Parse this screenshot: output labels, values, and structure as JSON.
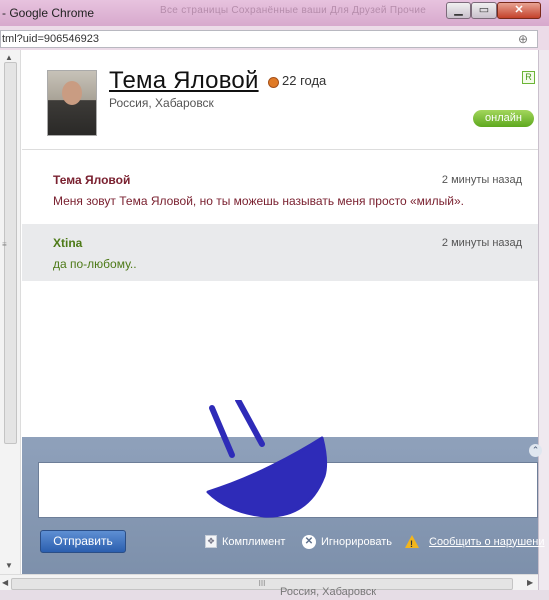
{
  "window": {
    "title": "- Google Chrome",
    "tab_ghost": "Все страницы   Сохранённые ваши   Для Друзей   Прочие"
  },
  "address": {
    "url": "tml?uid=906546923"
  },
  "profile": {
    "name": "Тема Яловой",
    "age": "22 года",
    "location": "Россия, Хабаровск",
    "badge": "R",
    "status": "онлайн"
  },
  "messages": [
    {
      "author": "Тема Яловой",
      "time": "2 минуты назад",
      "text": "Меня зовут Тема Яловой, но ты можешь называть меня просто «милый»."
    },
    {
      "author": "Xtina",
      "time": "2 минуты назад",
      "text": "да по-любому.."
    }
  ],
  "composer": {
    "send_label": "Отправить",
    "actions": {
      "compliment": "Комплимент",
      "ignore": "Игнорировать",
      "report": "Сообщить о нарушени"
    }
  },
  "scrollbar": {
    "grip": "≡",
    "hgrip": "III"
  },
  "background_ghost": "Россия, Хабаровск",
  "colors": {
    "name_color": "#7a2130",
    "reply_color": "#4d7a17",
    "online_green": "#6fb72a",
    "composer_blue": "#8597b2",
    "smiley_blue": "#2e2bb8"
  }
}
